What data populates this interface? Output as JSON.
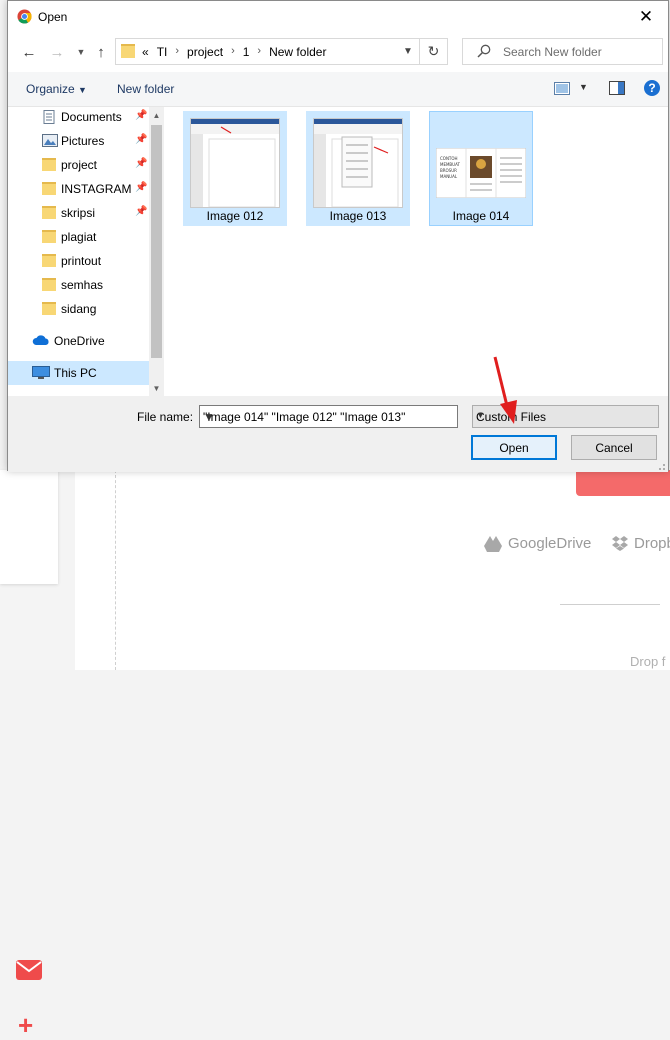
{
  "dialog": {
    "title": "Open",
    "breadcrumbs": [
      "TI",
      "project",
      "1",
      "New folder"
    ],
    "breadcrumb_prefix": "«",
    "search_placeholder": "Search New folder",
    "toolbar": {
      "organize": "Organize",
      "new_folder": "New folder"
    },
    "nav_items": [
      {
        "label": "Documents",
        "icon": "documents-icon",
        "pinned": true
      },
      {
        "label": "Pictures",
        "icon": "pictures-icon",
        "pinned": true
      },
      {
        "label": "project",
        "icon": "folder-icon",
        "pinned": true
      },
      {
        "label": "INSTAGRAM",
        "icon": "folder-icon",
        "pinned": true
      },
      {
        "label": "skripsi",
        "icon": "folder-icon",
        "pinned": true
      },
      {
        "label": "plagiat",
        "icon": "folder-icon",
        "pinned": false
      },
      {
        "label": "printout",
        "icon": "folder-icon",
        "pinned": false
      },
      {
        "label": "semhas",
        "icon": "folder-icon",
        "pinned": false
      },
      {
        "label": "sidang",
        "icon": "folder-icon",
        "pinned": false
      },
      {
        "label": "OneDrive",
        "icon": "onedrive-icon",
        "pinned": false
      },
      {
        "label": "This PC",
        "icon": "this-pc-icon",
        "pinned": false,
        "selected": true
      }
    ],
    "files": [
      {
        "name": "Image 012"
      },
      {
        "name": "Image 013"
      },
      {
        "name": "Image 014",
        "focused": true
      }
    ],
    "thumb_text_014": [
      "CONTOH",
      "MEMBUAT",
      "BROSUR",
      "MANUAL"
    ],
    "file_name_label": "File name:",
    "file_name_value": "\"Image 014\" \"Image 012\" \"Image 013\"",
    "file_type": "Custom Files",
    "open_label": "Open",
    "cancel_label": "Cancel"
  },
  "background": {
    "cloud_google": "GoogleDrive",
    "cloud_dropbox": "Dropb",
    "drop_text": "Drop f",
    "accent": "#ef4b4b"
  },
  "colors": {
    "selection": "#cce8ff",
    "primary_border": "#0078d7",
    "annotation_arrow": "#e01e1e"
  }
}
